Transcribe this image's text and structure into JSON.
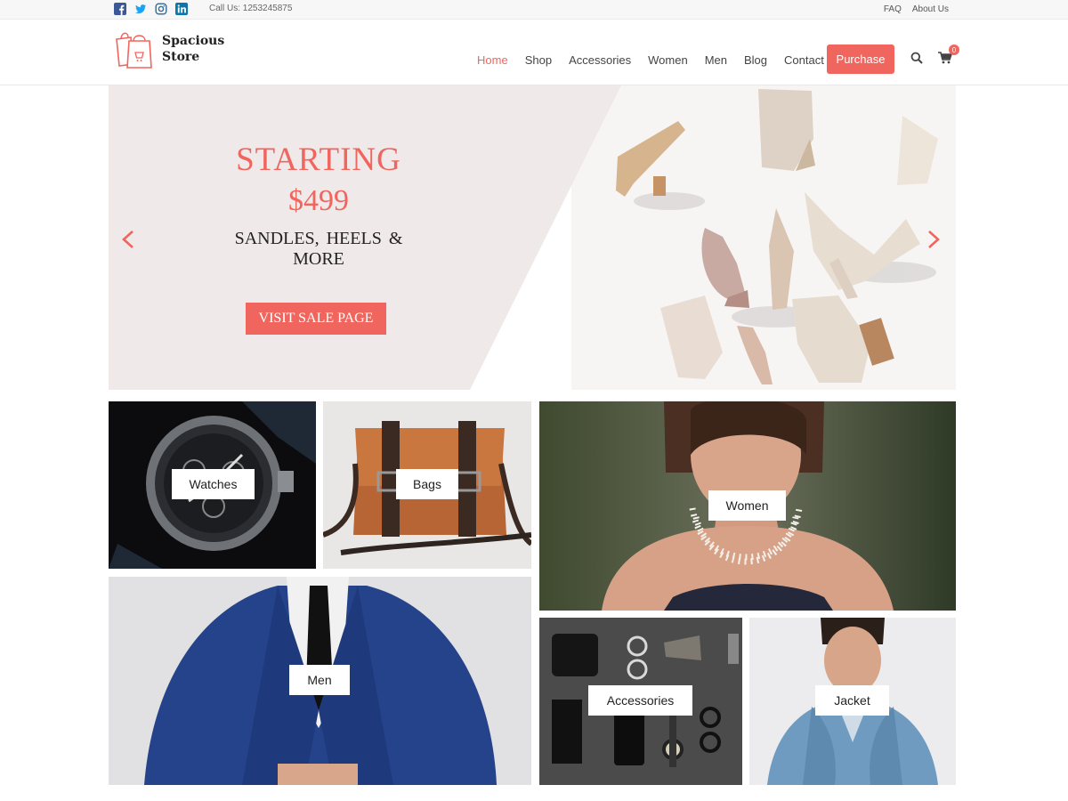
{
  "topbar": {
    "social_icons": [
      "facebook-icon",
      "twitter-icon",
      "instagram-icon",
      "linkedin-icon"
    ],
    "call_text": "Call Us: 1253245875",
    "links": [
      "FAQ",
      "About Us"
    ]
  },
  "header": {
    "logo_line1": "Spacious",
    "logo_line2": "Store",
    "nav": [
      "Home",
      "Shop",
      "Accessories",
      "Women",
      "Men",
      "Blog",
      "Contact"
    ],
    "active_nav": "Home",
    "purchase_label": "Purchase",
    "cart_count": "0",
    "icons": [
      "search-icon",
      "cart-icon"
    ]
  },
  "slider": {
    "line1": "STARTING",
    "line2": "$499",
    "line3": "SANDLES, HEELS & MORE",
    "button_label": "VISIT SALE PAGE",
    "icons": [
      "arrow-left-icon",
      "arrow-right-icon"
    ]
  },
  "categories": {
    "watches": "Watches",
    "bags": "Bags",
    "women": "Women",
    "men": "Men",
    "accessories": "Accessories",
    "jacket": "Jacket"
  },
  "colors": {
    "accent": "#f0655d",
    "slider_bg": "#efe9ea"
  }
}
